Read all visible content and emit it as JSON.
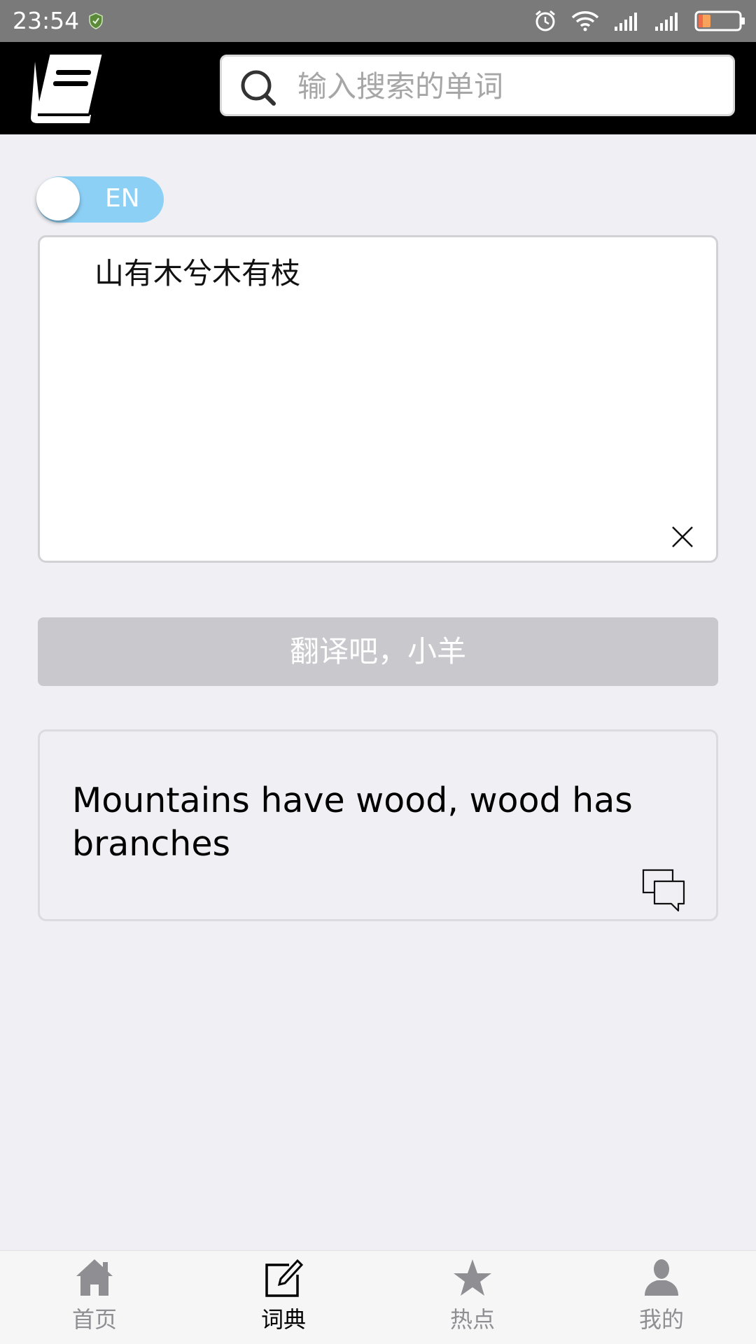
{
  "status_bar": {
    "time": "23:54",
    "icons": [
      "shield-icon",
      "alarm-icon",
      "wifi-icon",
      "signal-icon",
      "signal-icon",
      "battery-icon"
    ],
    "battery_level": 0.3
  },
  "header": {
    "logo": "book-icon",
    "search": {
      "placeholder": "输入搜索的单词",
      "value": ""
    }
  },
  "translator": {
    "language_toggle": {
      "label": "EN",
      "on": true,
      "color": "#8dd0f6"
    },
    "source_text": "山有木兮木有枝",
    "translate_button_label": "翻译吧，小羊",
    "result_text": "Mountains have wood, wood has branches"
  },
  "tabbar": {
    "items": [
      {
        "label": "首页",
        "icon": "home-icon",
        "active": false
      },
      {
        "label": "词典",
        "icon": "edit-icon",
        "active": true
      },
      {
        "label": "热点",
        "icon": "star-icon",
        "active": false
      },
      {
        "label": "我的",
        "icon": "user-icon",
        "active": false
      }
    ]
  },
  "colors": {
    "header_background": "#000000",
    "page_background": "#efeff4",
    "button_disabled": "#c8c8cd",
    "toggle_on": "#8dd0f6",
    "tab_inactive": "#8e8e93"
  }
}
